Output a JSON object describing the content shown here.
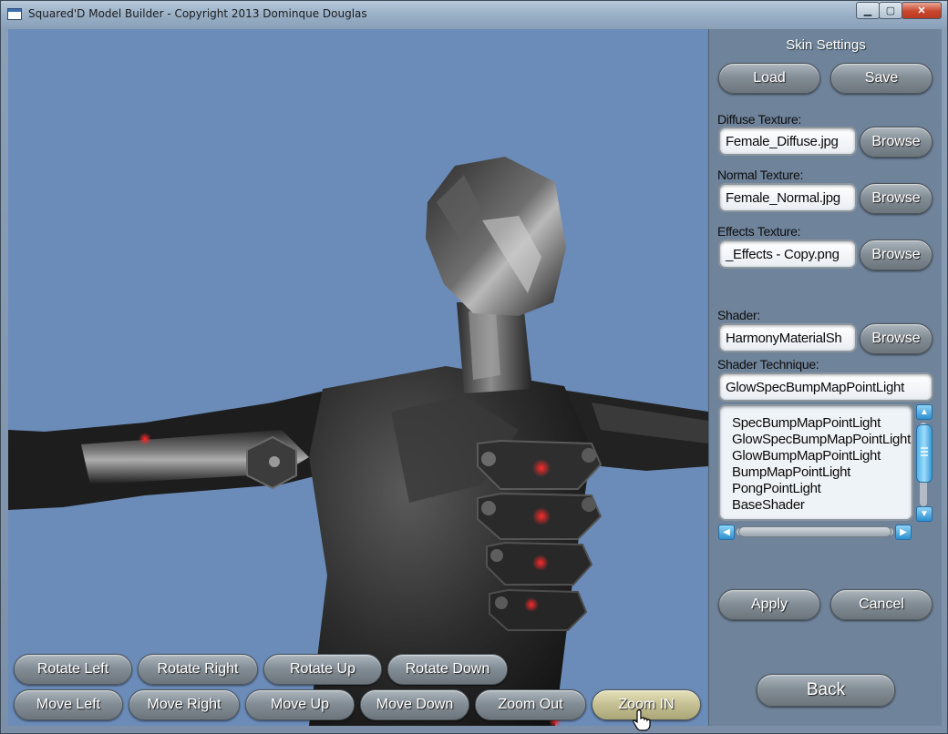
{
  "window": {
    "title": "Squared'D Model Builder - Copyright 2013 Dominque Douglas",
    "minimize": "▁",
    "maximize": "▢",
    "close": "✕"
  },
  "panel": {
    "title": "Skin Settings",
    "load": "Load",
    "save": "Save",
    "diffuse_label": "Diffuse Texture:",
    "diffuse_value": "Female_Diffuse.jpg",
    "normal_label": "Normal Texture:",
    "normal_value": "Female_Normal.jpg",
    "effects_label": "Effects Texture:",
    "effects_value": "_Effects - Copy.png",
    "shader_label": "Shader:",
    "shader_value": "HarmonyMaterialSh",
    "technique_label": "Shader Technique:",
    "technique_value": "GlowSpecBumpMapPointLight",
    "browse": "Browse",
    "techniques": [
      "SpecBumpMapPointLight",
      "GlowSpecBumpMapPointLight",
      "GlowBumpMapPointLight",
      "BumpMapPointLight",
      "PongPointLight",
      "BaseShader"
    ],
    "apply": "Apply",
    "cancel": "Cancel",
    "back": "Back"
  },
  "controls": {
    "rotate_left": "Rotate Left",
    "rotate_right": "Rotate Right",
    "rotate_up": "Rotate Up",
    "rotate_down": "Rotate Down",
    "move_left": "Move Left",
    "move_right": "Move Right",
    "move_up": "Move Up",
    "move_down": "Move Down",
    "zoom_out": "Zoom Out",
    "zoom_in": "Zoom IN"
  },
  "colors": {
    "viewport_bg": "#6b8cb9",
    "panel_bg": "#6f839a",
    "model": "#1e1e1e",
    "glow": "#e01b1b"
  },
  "icons": {
    "cursor": "hand-pointer-icon",
    "scroll_up": "chevron-up-icon",
    "scroll_down": "chevron-down-icon",
    "scroll_left": "chevron-left-icon",
    "scroll_right": "chevron-right-icon"
  }
}
